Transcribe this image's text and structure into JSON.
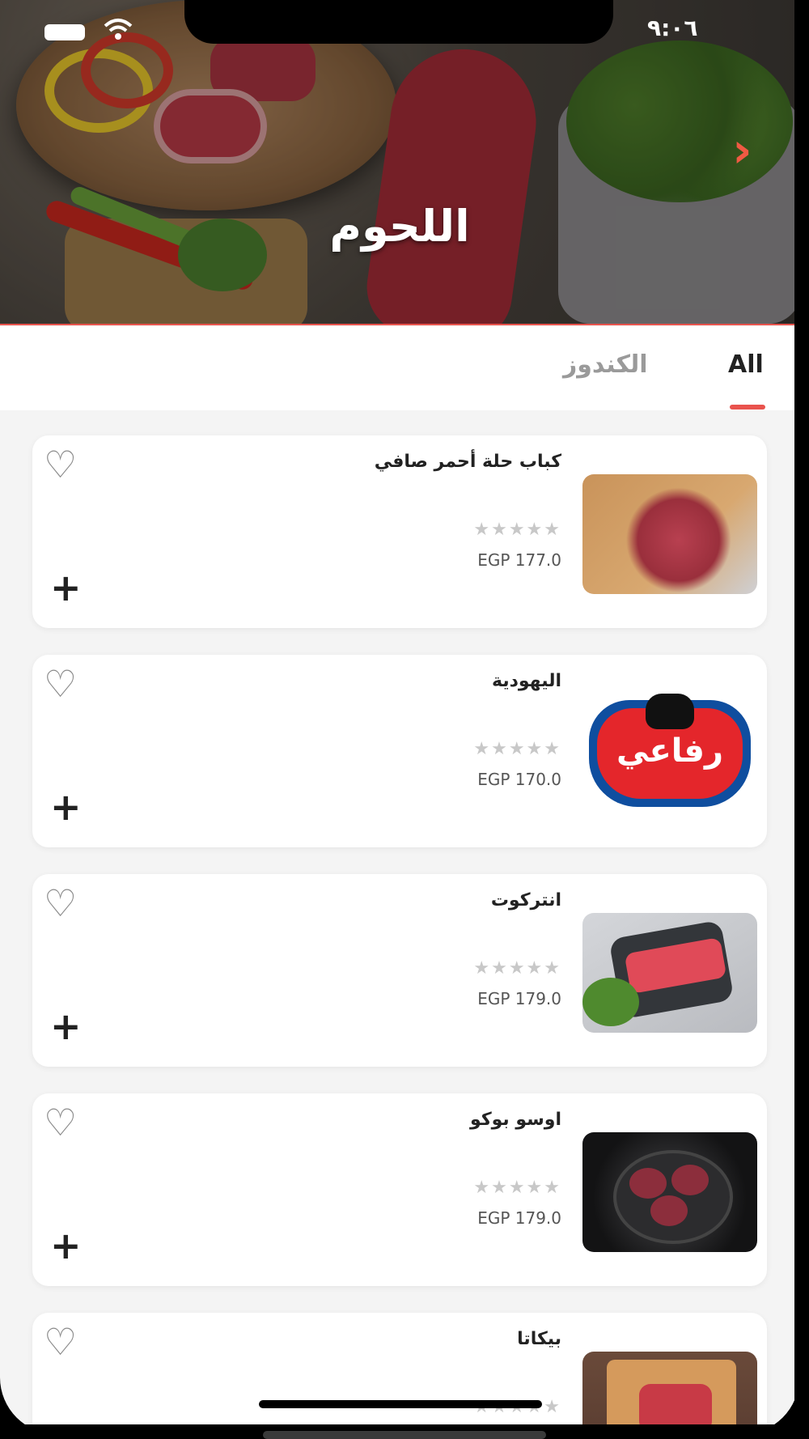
{
  "status_bar": {
    "time": "٩:٠٦"
  },
  "hero": {
    "title": "اللحوم"
  },
  "tabs": {
    "all": "All",
    "kandoz": "الكندوز"
  },
  "icons": {
    "favorite": "♡",
    "add": "+",
    "next": "›",
    "wifi": "wifi-icon",
    "battery": "battery-icon"
  },
  "products": [
    {
      "name": "كباب حلة أحمر صافي",
      "price": "EGP 177.0",
      "stars": "★★★★★",
      "rating": 0
    },
    {
      "name": "اليهودية",
      "price": "EGP 170.0",
      "stars": "★★★★★",
      "rating": 0,
      "logo_text": "رفاعي"
    },
    {
      "name": "انتركوت",
      "price": "EGP 179.0",
      "stars": "★★★★★",
      "rating": 0
    },
    {
      "name": "اوسو بوكو",
      "price": "EGP 179.0",
      "stars": "★★★★★",
      "rating": 0
    },
    {
      "name": "بيكاتا",
      "price": "",
      "stars": "★★★★★",
      "rating": 0
    }
  ],
  "colors": {
    "accent": "#e9534d",
    "background": "#f4f4f4",
    "star_inactive": "#c8c8c8"
  }
}
